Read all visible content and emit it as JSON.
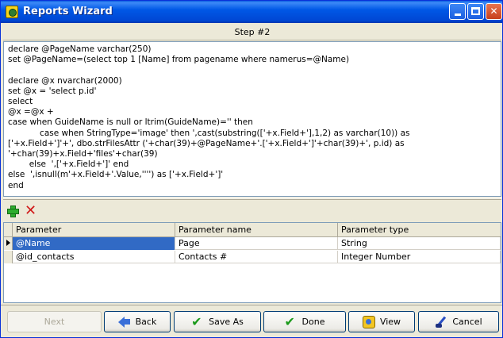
{
  "window": {
    "title": "Reports Wizard",
    "controls": {
      "minimize": "",
      "maximize": "",
      "close": "✕"
    }
  },
  "step": {
    "label": "Step #2"
  },
  "sql_text": "declare @PageName varchar(250)\nset @PageName=(select top 1 [Name] from pagename where namerus=@Name)\n\ndeclare @x nvarchar(2000)\nset @x = 'select p.id'\nselect\n@x =@x +\ncase when GuideName is null or ltrim(GuideName)='' then\n            case when StringType='image' then ',cast(substring(['+x.Field+'],1,2) as varchar(10)) as\n['+x.Field+']'+', dbo.strFilesAttr ('+char(39)+@PageName+'.['+x.Field+']'+char(39)+', p.id) as\n'+char(39)+x.Field+'files'+char(39)\n        else  ',['+x.Field+']' end\nelse  ',isnull(m'+x.Field+'.Value,'''') as ['+x.Field+']'\nend",
  "toolbar": {
    "add_icon": "plus-icon",
    "delete_icon": "cross-icon"
  },
  "grid": {
    "columns": [
      "Parameter",
      "Parameter name",
      "Parameter type"
    ],
    "rows": [
      {
        "parameter": "@Name",
        "name": "Page",
        "type": "String"
      },
      {
        "parameter": "@id_contacts",
        "name": "Contacts #",
        "type": "Integer Number"
      }
    ],
    "selected_row": 0
  },
  "buttons": {
    "next": "Next",
    "back": "Back",
    "save_as": "Save As",
    "done": "Done",
    "view": "View",
    "cancel": "Cancel"
  },
  "colors": {
    "titlebar": "#0058e6",
    "selection": "#316ac5",
    "face": "#ece9d8"
  }
}
